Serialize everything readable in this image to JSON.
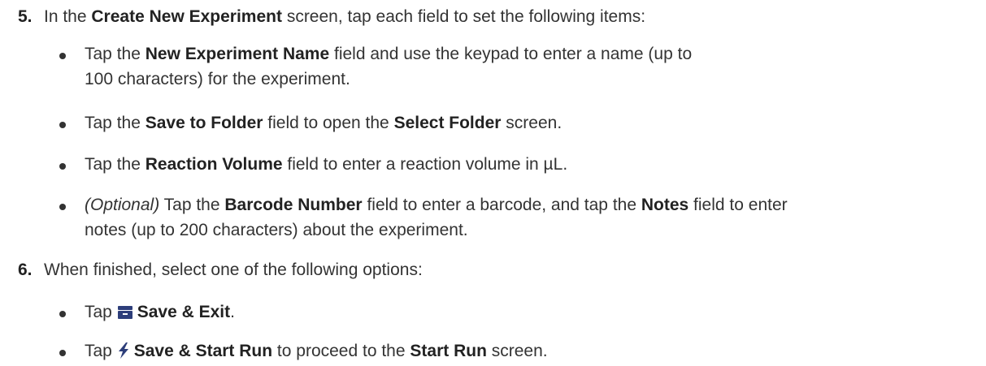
{
  "step5": {
    "number": "5.",
    "intro_1": "In the ",
    "intro_bold": "Create New Experiment",
    "intro_2": " screen, tap each field to set the following items:",
    "bullets": {
      "name": {
        "t1": "Tap the ",
        "b1": "New Experiment Name",
        "t2": " field and use the keypad to enter a name (up to",
        "line2": "100 characters) for the experiment."
      },
      "folder": {
        "t1": "Tap the ",
        "b1": "Save to Folder",
        "t2": " field to open the ",
        "b2": "Select Folder",
        "t3": " screen."
      },
      "volume": {
        "t1": "Tap the ",
        "b1": "Reaction Volume",
        "t2": " field to enter a reaction volume in µL."
      },
      "barcode": {
        "optional": "(Optional)",
        "t1": " Tap the ",
        "b1": "Barcode Number",
        "t2": " field to enter a barcode, and tap the ",
        "b2": "Notes",
        "t3": " field to enter",
        "line2": "notes (up to 200 characters) about the experiment."
      }
    }
  },
  "step6": {
    "number": "6.",
    "intro": "When finished, select one of the following options:",
    "bullets": {
      "save_exit": {
        "t1": "Tap ",
        "icon": "save-box-icon",
        "b1": "Save & Exit",
        "t2": "."
      },
      "save_start": {
        "t1": "Tap ",
        "icon": "lightning-icon",
        "b1": "Save & Start Run",
        "t2": " to proceed to the ",
        "b2": "Start Run",
        "t3": " screen."
      }
    }
  },
  "colors": {
    "text": "#333333",
    "icon": "#2d3e7a"
  }
}
